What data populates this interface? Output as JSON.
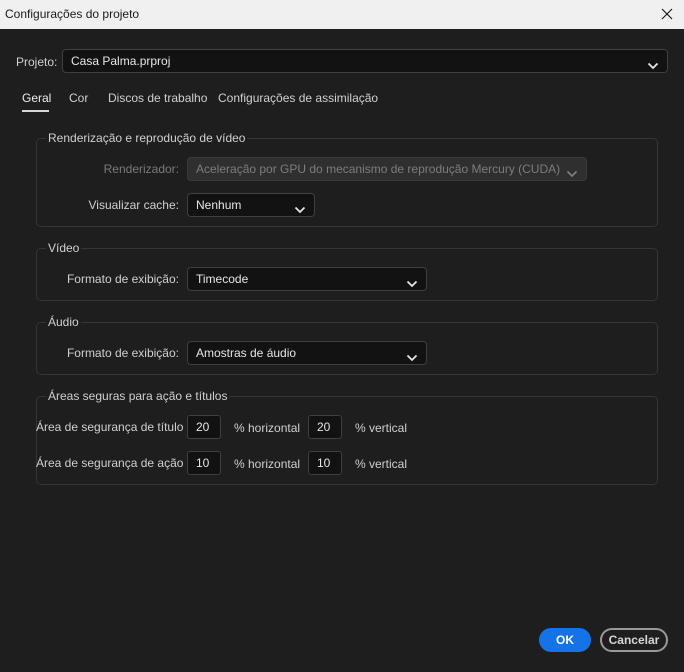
{
  "window": {
    "title": "Configurações do projeto"
  },
  "project": {
    "label": "Projeto:",
    "value": "Casa Palma.prproj"
  },
  "tabs": [
    {
      "label": "Geral",
      "active": true
    },
    {
      "label": "Cor",
      "active": false
    },
    {
      "label": "Discos de trabalho",
      "active": false
    },
    {
      "label": "Configurações de assimilação",
      "active": false
    }
  ],
  "render": {
    "title": "Renderização e reprodução de vídeo",
    "renderer_label": "Renderizador:",
    "renderer_value": "Aceleração por GPU do mecanismo de reprodução Mercury (CUDA)",
    "cache_label": "Visualizar cache:",
    "cache_value": "Nenhum"
  },
  "video": {
    "title": "Vídeo",
    "format_label": "Formato de exibição:",
    "format_value": "Timecode"
  },
  "audio": {
    "title": "Áudio",
    "format_label": "Formato de exibição:",
    "format_value": "Amostras de áudio"
  },
  "safe": {
    "title": "Áreas seguras para ação e títulos",
    "title_label": "Área de segurança de título",
    "title_h": "20",
    "title_v": "20",
    "action_label": "Área de segurança de ação",
    "action_h": "10",
    "action_v": "10",
    "h_suffix": "% horizontal",
    "v_suffix": "% vertical"
  },
  "buttons": {
    "ok": "OK",
    "cancel": "Cancelar"
  },
  "colors": {
    "accent": "#1473e6",
    "background": "#1e1e1e",
    "titlebar": "#f0f0f0"
  }
}
